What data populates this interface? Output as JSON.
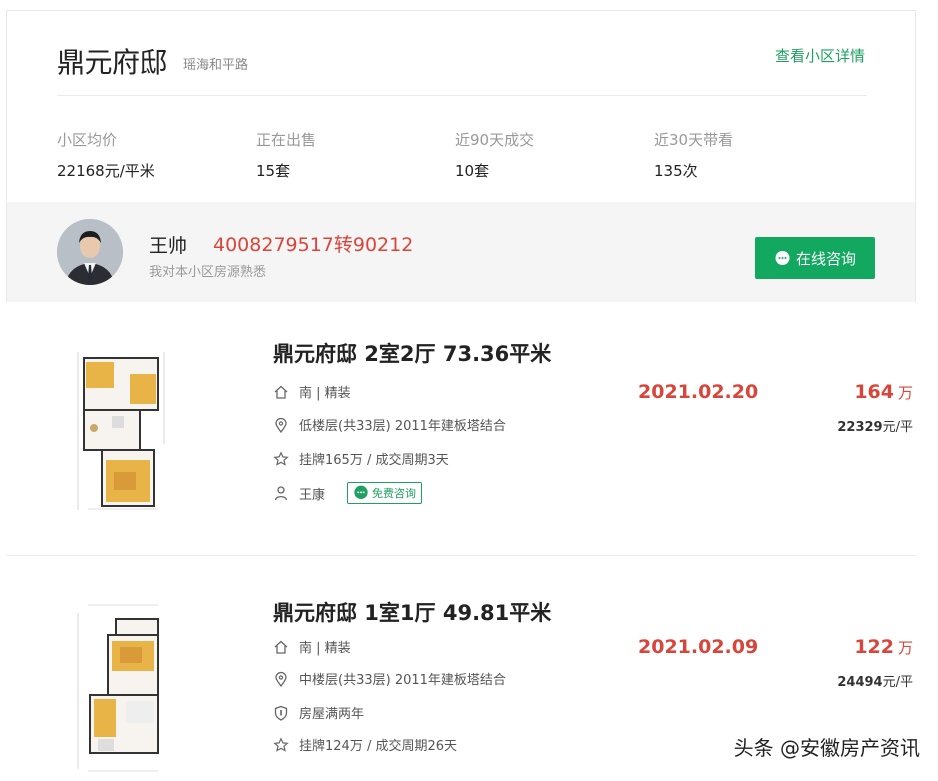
{
  "community": {
    "name": "鼎元府邸",
    "road": "瑶海和平路",
    "detail_link": "查看小区详情",
    "stats": [
      {
        "label": "小区均价",
        "value": "22168元/平米"
      },
      {
        "label": "正在出售",
        "value": "15套"
      },
      {
        "label": "近90天成交",
        "value": "10套"
      },
      {
        "label": "近30天带看",
        "value": "135次"
      }
    ]
  },
  "agent": {
    "name": "王帅",
    "phone": "4008279517转90212",
    "desc": "我对本小区房源熟悉",
    "consult_button": "在线咨询"
  },
  "listings": [
    {
      "title": "鼎元府邸 2室2厅 73.36平米",
      "orientation": "南 | 精装",
      "floor": "低楼层(共33层) 2011年建板塔结合",
      "deal": "挂牌165万 / 成交周期3天",
      "agent": "王康",
      "free_consult": "免费咨询",
      "date": "2021.02.20",
      "price": "164",
      "price_unit": "万",
      "unit_price": "22329",
      "unit_price_suffix": "元/平"
    },
    {
      "title": "鼎元府邸 1室1厅 49.81平米",
      "orientation": "南 | 精装",
      "floor": "中楼层(共33层) 2011年建板塔结合",
      "tag": "房屋满两年",
      "deal": "挂牌124万 / 成交周期26天",
      "date": "2021.02.09",
      "price": "122",
      "price_unit": "万",
      "unit_price": "24494",
      "unit_price_suffix": "元/平"
    }
  ],
  "watermark": "头条 @安徽房产资讯",
  "colors": {
    "accent_green": "#12a860",
    "price_red": "#d8453b"
  }
}
